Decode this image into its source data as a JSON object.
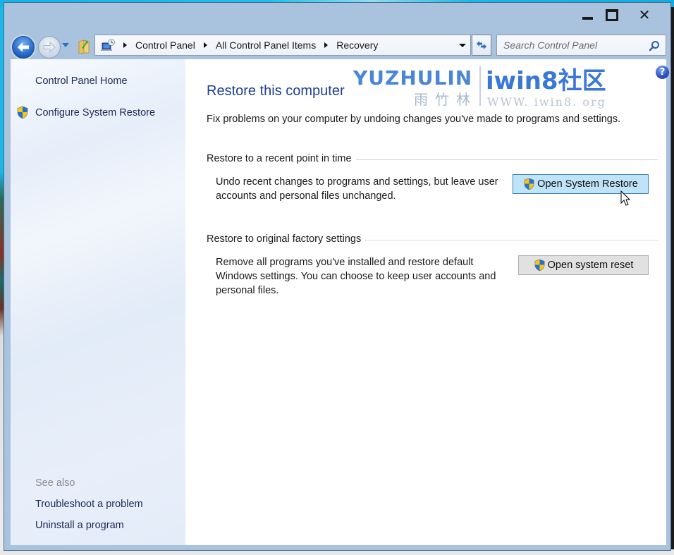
{
  "window": {
    "caption_buttons": {
      "minimize_icon": "minimize-icon",
      "maximize_icon": "maximize-icon",
      "close_icon": "close-icon",
      "close_glyph": "✕"
    }
  },
  "navigation": {
    "back_icon": "back-arrow-icon",
    "forward_icon": "forward-arrow-icon",
    "recent_icon": "chevron-down-icon",
    "up_icon": "folder-up-icon"
  },
  "address_bar": {
    "root_icon": "control-panel-icon",
    "breadcrumbs": [
      "Control Panel",
      "All Control Panel Items",
      "Recovery"
    ]
  },
  "search": {
    "placeholder": "Search Control Panel",
    "value": ""
  },
  "sidebar": {
    "links": [
      {
        "label": "Control Panel Home",
        "icon": null
      },
      {
        "label": "Configure System Restore",
        "icon": "uac-shield-icon"
      }
    ],
    "see_also_label": "See also",
    "see_also_links": [
      "Troubleshoot a problem",
      "Uninstall a program"
    ]
  },
  "main": {
    "title": "Restore this computer",
    "intro": "Fix problems on your computer by undoing changes you've made to programs and settings.",
    "help_glyph": "?",
    "sections": [
      {
        "heading": "Restore to a recent point in time",
        "description": "Undo recent changes to programs and settings, but leave user accounts and personal files unchanged.",
        "button_label": "Open System Restore",
        "button_state": "hover"
      },
      {
        "heading": "Restore to original factory settings",
        "description": "Remove all programs you've installed and restore default Windows settings. You can choose to keep user accounts and personal files.",
        "button_label": "Open system reset",
        "button_state": "normal"
      }
    ]
  },
  "watermark": {
    "brand_latin": "YUZHULIN",
    "brand_cn": "雨竹林",
    "site_name": "iwin8社区",
    "url": "WWW. iwin8. org"
  },
  "colors": {
    "title_blue": "#1e3f9a",
    "link_navy": "#1d2a55",
    "frame": "#a9c3de",
    "hover_button_bg": "#bfe3f8",
    "hover_button_border": "#3c7fb1",
    "watermark_blue": "#3a78d8"
  }
}
